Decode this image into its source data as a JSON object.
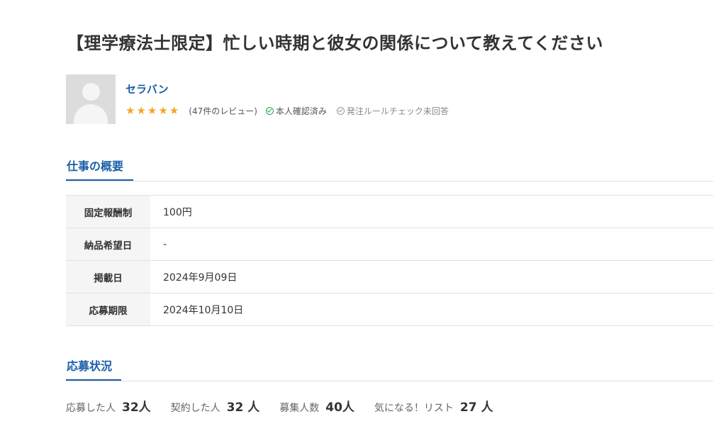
{
  "job": {
    "title": "【理学療法士限定】忙しい時期と彼女の関係について教えてください"
  },
  "client": {
    "name": "セラバン",
    "rating_stars": 5,
    "star_glyphs": [
      "★",
      "★",
      "★",
      "★",
      "★"
    ],
    "reviews": "(47件のレビュー)",
    "verified": "本人確認済み",
    "rule_check": "発注ルールチェック未回答"
  },
  "overview": {
    "heading": "仕事の概要",
    "rows": [
      {
        "label": "固定報酬制",
        "value": "100円"
      },
      {
        "label": "納品希望日",
        "value": "-"
      },
      {
        "label": "掲載日",
        "value": "2024年9月09日"
      },
      {
        "label": "応募期限",
        "value": "2024年10月10日"
      }
    ]
  },
  "status": {
    "heading": "応募状況",
    "items": [
      {
        "label": "応募した人",
        "value": "32人"
      },
      {
        "label": "契約した人",
        "value": "32 人"
      },
      {
        "label": "募集人数",
        "value": "40人"
      },
      {
        "label": "気になる！リスト",
        "value": "27 人"
      }
    ]
  },
  "colors": {
    "accent": "#1a5fa8",
    "star": "#f5a623",
    "verified": "#2e9e57"
  }
}
